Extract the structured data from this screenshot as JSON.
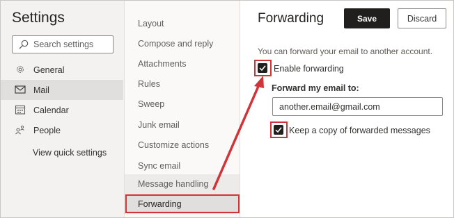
{
  "settings_pane": {
    "title": "Settings",
    "search_placeholder": "Search settings",
    "nav": [
      {
        "label": "General",
        "icon": "gear-icon"
      },
      {
        "label": "Mail",
        "icon": "mail-icon",
        "selected": true
      },
      {
        "label": "Calendar",
        "icon": "calendar-icon"
      },
      {
        "label": "People",
        "icon": "people-icon"
      }
    ],
    "quick_settings": "View quick settings"
  },
  "mail_categories": {
    "items": [
      "Layout",
      "Compose and reply",
      "Attachments",
      "Rules",
      "Sweep",
      "Junk email",
      "Customize actions",
      "Sync email",
      "Message handling",
      "Forwarding"
    ],
    "selected": "Forwarding"
  },
  "forwarding": {
    "title": "Forwarding",
    "save_label": "Save",
    "discard_label": "Discard",
    "description": "You can forward your email to another account.",
    "enable_label": "Enable forwarding",
    "enable_checked": true,
    "forward_to_label": "Forward my email to:",
    "email_value": "another.email@gmail.com",
    "keep_copy_label": "Keep a copy of forwarded messages",
    "keep_copy_checked": true
  },
  "colors": {
    "highlight": "#d13438",
    "checkbox": "#201f1e",
    "save_button": "#201f1e"
  }
}
